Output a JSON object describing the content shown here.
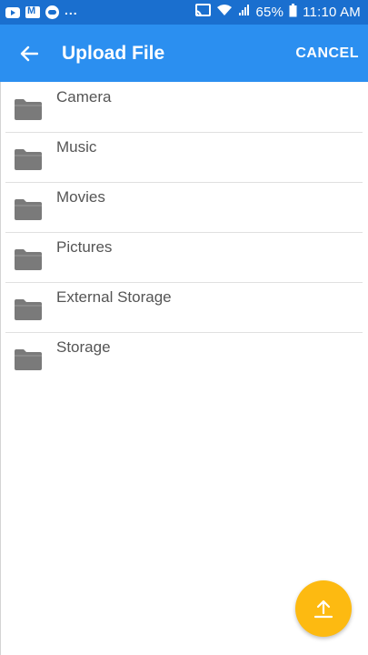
{
  "status_bar": {
    "icons": [
      "youtube-icon",
      "gmail-icon",
      "cloud-icon",
      "more-notifications-icon",
      "cast-icon",
      "wifi-icon",
      "signal-icon",
      "battery-icon"
    ],
    "more": "...",
    "battery": "65%",
    "time": "11:10 AM"
  },
  "app_bar": {
    "title": "Upload File",
    "cancel_label": "CANCEL",
    "color": "#2b8ff0"
  },
  "folders": [
    {
      "label": "Camera"
    },
    {
      "label": "Music"
    },
    {
      "label": "Movies"
    },
    {
      "label": "Pictures"
    },
    {
      "label": "External Storage"
    },
    {
      "label": "Storage"
    }
  ],
  "fab": {
    "icon": "upload-arrow-icon",
    "color": "#fdba11"
  }
}
